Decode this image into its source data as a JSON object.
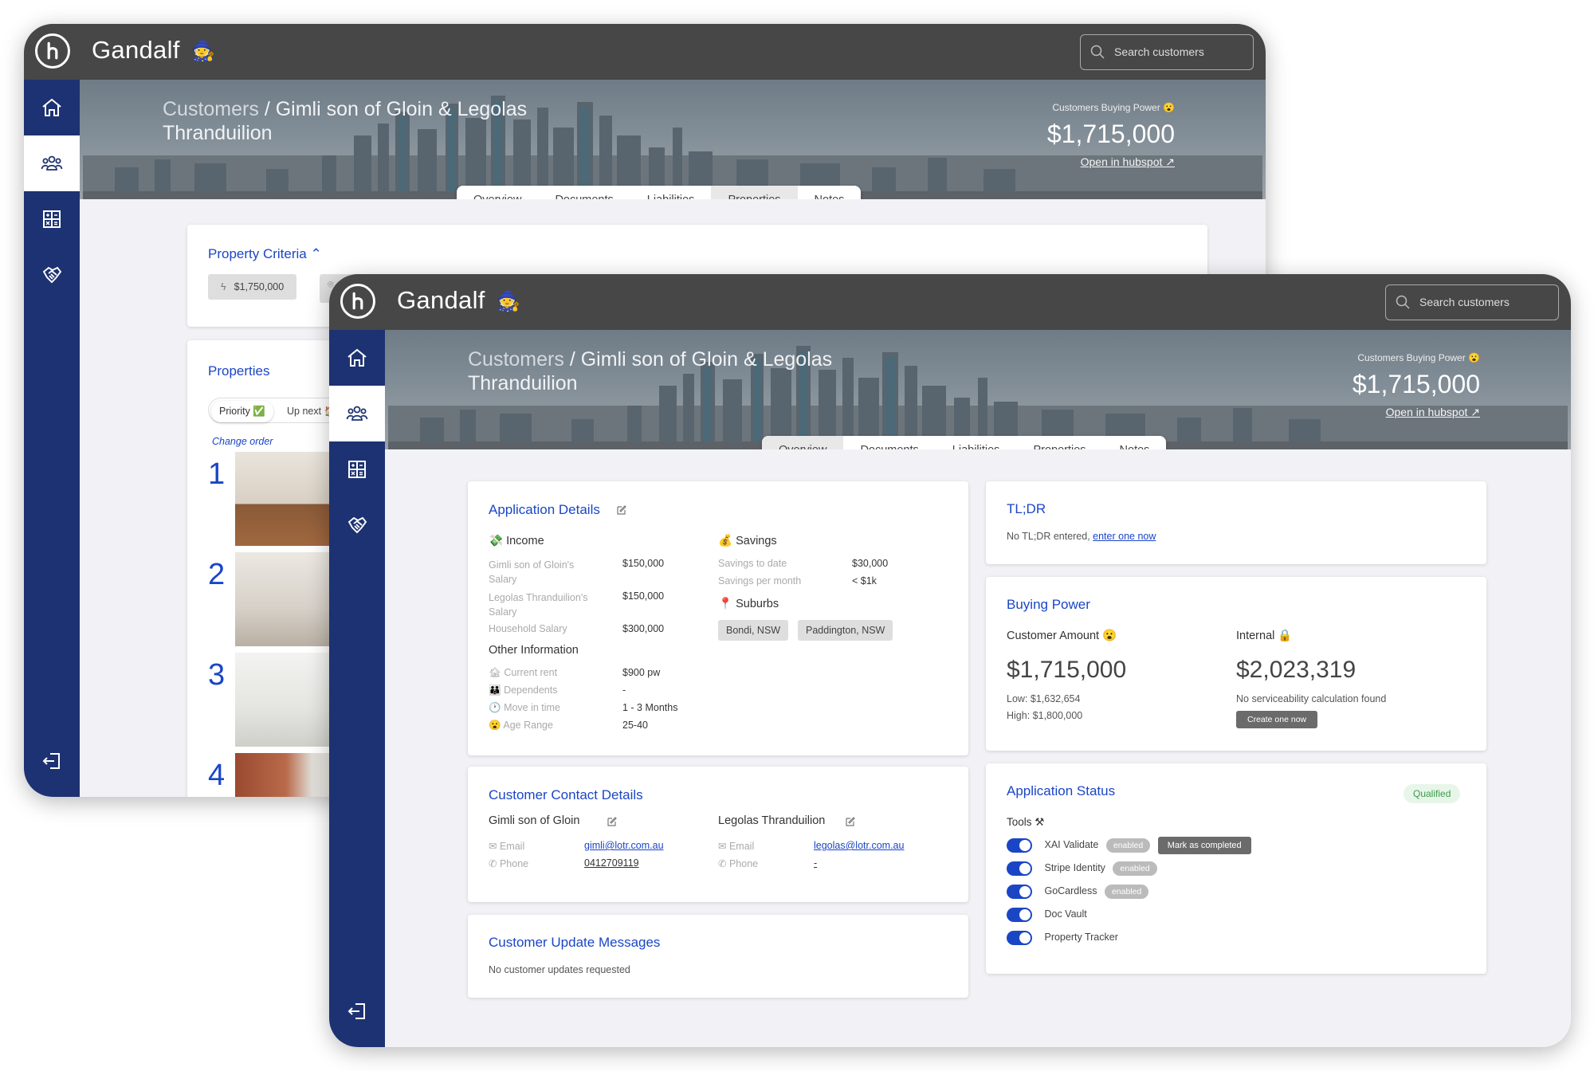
{
  "app": {
    "brand": "Gandalf",
    "brand_emoji": "🧙",
    "search_placeholder": "Search customers"
  },
  "header": {
    "crumb_root": "Customers",
    "crumb_sep": " / ",
    "customer_name": "Gimli son of Gloin & Legolas Thranduilion",
    "buying_power_label": "Customers Buying Power 😮",
    "buying_power": "$1,715,000",
    "hubspot_link": "Open in hubspot ↗"
  },
  "tabs": [
    "Overview",
    "Documents",
    "Liabilities",
    "Properties",
    "Notes"
  ],
  "back": {
    "selected_tab": "Properties",
    "criteria_title": "Property Criteria ⌃",
    "criteria_price": "$1,750,000",
    "properties_title": "Properties",
    "seg_priority": "Priority ✅",
    "seg_upnext": "Up next 🏠",
    "change_order": "Change order",
    "ranks": [
      "1",
      "2",
      "3",
      "4"
    ]
  },
  "front": {
    "selected_tab": "Overview",
    "app_details": {
      "title": "Application Details",
      "income_title": "Income",
      "income_emoji": "💸",
      "income_rows": [
        {
          "label": "Gimli son of Gloin's Salary",
          "value": "$150,000"
        },
        {
          "label": "Legolas Thranduilion's Salary",
          "value": "$150,000"
        },
        {
          "label": "Household Salary",
          "value": "$300,000"
        }
      ],
      "savings_title": "Savings",
      "savings_emoji": "💰",
      "savings_rows": [
        {
          "label": "Savings to date",
          "value": "$30,000"
        },
        {
          "label": "Savings per month",
          "value": "< $1k"
        }
      ],
      "suburbs_title": "Suburbs",
      "suburbs_emoji": "📍",
      "suburbs": [
        "Bondi, NSW",
        "Paddington, NSW"
      ],
      "other_title": "Other Information",
      "other_rows": [
        {
          "emoji": "🏚",
          "label": "Current rent",
          "value": "$900 pw"
        },
        {
          "emoji": "👪",
          "label": "Dependents",
          "value": "-"
        },
        {
          "emoji": "🕐",
          "label": "Move in time",
          "value": "1 - 3 Months"
        },
        {
          "emoji": "😮",
          "label": "Age Range",
          "value": "25-40"
        }
      ]
    },
    "tldr": {
      "title": "TL;DR",
      "text": "No TL;DR entered, ",
      "link": "enter one now"
    },
    "buying_power": {
      "title": "Buying Power",
      "customer_label": "Customer Amount 😮",
      "customer_amount": "$1,715,000",
      "low_label": "Low:",
      "low": "$1,632,654",
      "high_label": "High:",
      "high": "$1,800,000",
      "internal_label": "Internal 🔒",
      "internal_amount": "$2,023,319",
      "no_calc": "No serviceability calculation found",
      "create_btn": "Create one now"
    },
    "contact": {
      "title": "Customer Contact Details",
      "people": [
        {
          "name": "Gimli son of Gloin",
          "email_label": "Email",
          "email": "gimli@lotr.com.au",
          "phone_label": "Phone",
          "phone": "0412709119"
        },
        {
          "name": "Legolas Thranduilion",
          "email_label": "Email",
          "email": "legolas@lotr.com.au",
          "phone_label": "Phone",
          "phone": "-"
        }
      ]
    },
    "status": {
      "title": "Application Status",
      "badge": "Qualified",
      "tools_label": "Tools ⚒",
      "tools": [
        {
          "name": "XAI Validate",
          "badge": "enabled",
          "action": "Mark as completed"
        },
        {
          "name": "Stripe Identity",
          "badge": "enabled"
        },
        {
          "name": "GoCardless",
          "badge": "enabled"
        },
        {
          "name": "Doc Vault"
        },
        {
          "name": "Property Tracker"
        }
      ]
    },
    "updates": {
      "title": "Customer Update Messages",
      "text": "No customer updates requested"
    }
  },
  "colors": {
    "nav": "#1d3272",
    "topbar": "#474747",
    "accent": "#1a46c6"
  }
}
